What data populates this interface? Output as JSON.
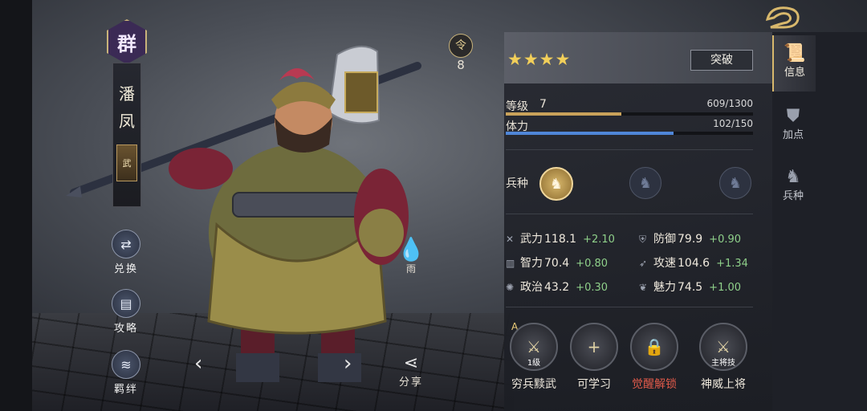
{
  "hero": {
    "faction": "群",
    "name_chars": [
      "潘",
      "凤"
    ],
    "class_tag": "武",
    "weather_label": "雨",
    "token_icon": "令",
    "token_value": "8"
  },
  "side_actions": [
    {
      "label": "兑换",
      "icon": "exchange-icon"
    },
    {
      "label": "攻略",
      "icon": "guide-icon"
    },
    {
      "label": "羁绊",
      "icon": "bond-icon"
    }
  ],
  "share_label": "分享",
  "info": {
    "stars": "★★★★",
    "star_count": 4,
    "breakthrough_label": "突破",
    "level_label": "等级",
    "level_value": "7",
    "exp_text": "609/1300",
    "exp_ratio": 0.468,
    "stamina_label": "体力",
    "stamina_text": "102/150",
    "stamina_ratio": 0.68,
    "troop_label": "兵种"
  },
  "attributes": [
    {
      "name": "武力",
      "value": "118.1",
      "bonus": "+2.10",
      "icon": "sword-icon"
    },
    {
      "name": "防御",
      "value": "79.9",
      "bonus": "+0.90",
      "icon": "shield-icon"
    },
    {
      "name": "智力",
      "value": "70.4",
      "bonus": "+0.80",
      "icon": "book-icon"
    },
    {
      "name": "攻速",
      "value": "104.6",
      "bonus": "+1.34",
      "icon": "speed-icon"
    },
    {
      "name": "政治",
      "value": "43.2",
      "bonus": "+0.30",
      "icon": "politics-icon"
    },
    {
      "name": "魅力",
      "value": "74.5",
      "bonus": "+1.00",
      "icon": "charm-icon"
    }
  ],
  "skills": [
    {
      "label": "穷兵黩武",
      "badge": "1级",
      "mark": "A"
    },
    {
      "label": "可学习",
      "symbol": "+"
    },
    {
      "label": "觉醒解锁"
    },
    {
      "label": "神威上将",
      "badge": "主将技"
    }
  ],
  "tabs": [
    {
      "label": "信息",
      "active": true
    },
    {
      "label": "加点"
    },
    {
      "label": "兵种"
    }
  ],
  "colors": {
    "accent_gold": "#d8b86c",
    "exp_bar": "#c9a25a",
    "stamina_bar": "#4f86d8",
    "bonus_green": "#8fd08a",
    "locked_red": "#e05a4a"
  }
}
